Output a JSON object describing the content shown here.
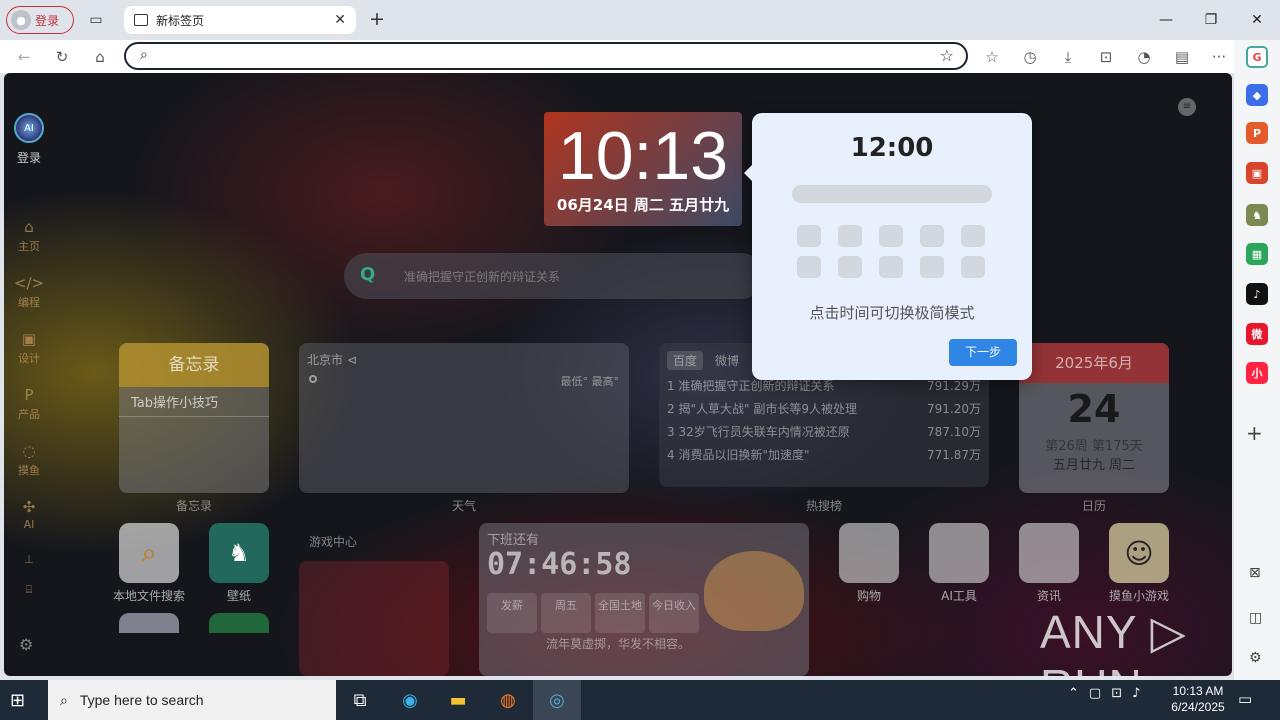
{
  "browser": {
    "profile_label": "登录",
    "tab_title": "新标签页",
    "tab_close": "✕",
    "new_tab": "+",
    "win_min": "—",
    "win_max": "❐",
    "win_close": "✕",
    "address_value": "",
    "nav_icons": [
      "back-icon",
      "refresh-icon",
      "home-icon"
    ],
    "toolbar_icons": [
      "favorites-icon",
      "history-icon",
      "download-icon",
      "screenshot-icon",
      "speed-icon",
      "toolbox-icon",
      "more-icon"
    ],
    "more_label": "···"
  },
  "sidebar_right": {
    "apps": [
      "G",
      "◆",
      "P",
      "▣",
      "♞",
      "▦",
      "♪",
      "微",
      "小"
    ],
    "add": "+"
  },
  "page": {
    "login_label": "登录",
    "nav": [
      {
        "icon": "⌂",
        "label": "主页"
      },
      {
        "icon": "</>",
        "label": "编程"
      },
      {
        "icon": "▣",
        "label": "设计"
      },
      {
        "icon": "P",
        "label": "产品"
      },
      {
        "icon": "◌",
        "label": "摸鱼"
      },
      {
        "icon": "✣",
        "label": "AI"
      }
    ],
    "clock_time": "10:13",
    "clock_date": "06月24日 周二 五月廿九",
    "search_placeholder": "准确把握守正创新的辩证关系",
    "memo_title": "备忘录",
    "memo_item": "Tab操作小技巧",
    "memo_caption": "备忘录",
    "weather_city": "北京市 ⊲",
    "weather_range": "最低° 最高°",
    "weather_caption": "天气",
    "hot_tabs": [
      "百度",
      "微博"
    ],
    "hot_list": [
      {
        "rank": "1",
        "title": "准确把握守正创新的辩证关系",
        "value": "791.29万"
      },
      {
        "rank": "2",
        "title": "揭\"人草大战\" 副市长等9人被处理",
        "value": "791.20万"
      },
      {
        "rank": "3",
        "title": "32岁飞行员失联车内情况被还原",
        "value": "787.10万"
      },
      {
        "rank": "4",
        "title": "消费品以旧换新\"加速度\"",
        "value": "771.87万"
      }
    ],
    "hot_caption": "热搜榜",
    "cal_header": "2025年6月",
    "cal_day": "24",
    "cal_week": "第26周 第175天",
    "cal_lunar": "五月廿九   周二",
    "cal_caption": "日历",
    "app_file_search": "本地文件搜索",
    "app_wallpaper": "壁纸",
    "game_center": "游戏中心",
    "countdown_title": "下班还有",
    "countdown_value": "07:46:58",
    "countdown_cells": [
      "发薪",
      "周五",
      "全国土地",
      "今日收入"
    ],
    "app_shopping": "购物",
    "app_ai_tools": "AI工具",
    "app_news": "资讯",
    "app_games": "摸鱼小游戏",
    "footer": "流年莫虚掷，华发不相容。"
  },
  "popup": {
    "time": "12:00",
    "tip": "点击时间可切换极简模式",
    "next": "下一步"
  },
  "watermark": "ANY ▷ RUN",
  "taskbar": {
    "search_placeholder": "Type here to search",
    "time": "10:13 AM",
    "date": "6/24/2025"
  }
}
